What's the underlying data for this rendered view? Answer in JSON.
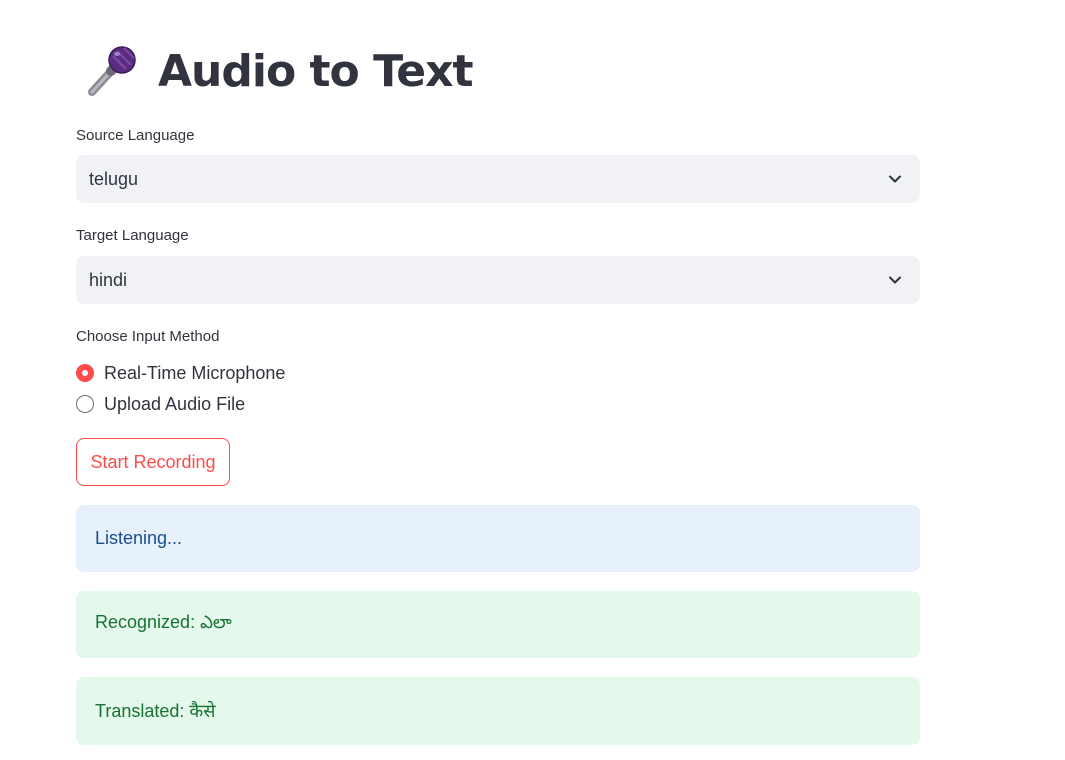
{
  "header": {
    "title": "Audio to Text",
    "icon": "microphone-icon"
  },
  "source_language": {
    "label": "Source Language",
    "value": "telugu"
  },
  "target_language": {
    "label": "Target Language",
    "value": "hindi"
  },
  "input_method": {
    "label": "Choose Input Method",
    "options": [
      {
        "label": "Real-Time Microphone",
        "selected": true
      },
      {
        "label": "Upload Audio File",
        "selected": false
      }
    ]
  },
  "record_button": {
    "label": "Start Recording"
  },
  "status": {
    "listening": "Listening...",
    "recognized": "Recognized: ఎలా",
    "translated": "Translated: कैसे"
  },
  "colors": {
    "accent": "#ff4b4b",
    "select_bg": "#f0f2f6",
    "info_bg": "#e6f1fc",
    "info_text": "#1d4e89",
    "success_bg": "#e5f8ec",
    "success_text": "#177233"
  }
}
